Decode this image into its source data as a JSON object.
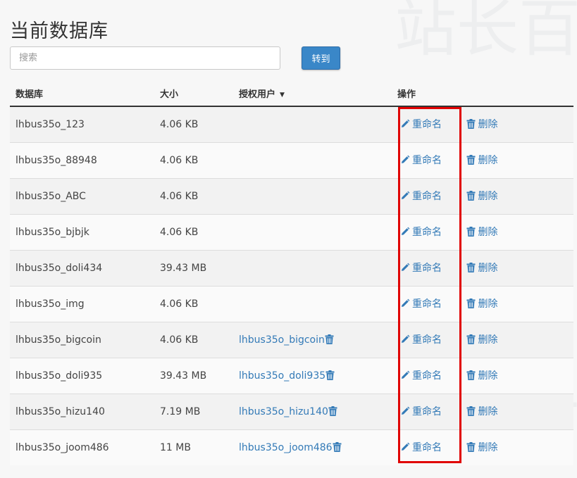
{
  "page": {
    "title": "当前数据库"
  },
  "search": {
    "placeholder": "搜索",
    "value": "",
    "go_label": "转到"
  },
  "table": {
    "headers": {
      "database": "数据库",
      "size": "大小",
      "users": "授权用户",
      "actions": "操作"
    },
    "rename_label": "重命名",
    "delete_label": "删除",
    "rows": [
      {
        "name": "lhbus35o_123",
        "size": "4.06 KB",
        "user": ""
      },
      {
        "name": "lhbus35o_88948",
        "size": "4.06 KB",
        "user": ""
      },
      {
        "name": "lhbus35o_ABC",
        "size": "4.06 KB",
        "user": ""
      },
      {
        "name": "lhbus35o_bjbjk",
        "size": "4.06 KB",
        "user": ""
      },
      {
        "name": "lhbus35o_doli434",
        "size": "39.43 MB",
        "user": ""
      },
      {
        "name": "lhbus35o_img",
        "size": "4.06 KB",
        "user": ""
      },
      {
        "name": "lhbus35o_bigcoin",
        "size": "4.06 KB",
        "user": "lhbus35o_bigcoin"
      },
      {
        "name": "lhbus35o_doli935",
        "size": "39.43 MB",
        "user": "lhbus35o_doli935"
      },
      {
        "name": "lhbus35o_hizu140",
        "size": "7.19 MB",
        "user": "lhbus35o_hizu140"
      },
      {
        "name": "lhbus35o_joom486",
        "size": "11 MB",
        "user": "lhbus35o_joom486"
      }
    ]
  },
  "icons": {
    "rename": "pencil-icon",
    "delete": "trash-icon",
    "user_delete": "trash-icon",
    "sort": "caret-down-icon"
  },
  "colors": {
    "link": "#337ab7",
    "button": "#3a87c8",
    "highlight": "#e00000"
  }
}
